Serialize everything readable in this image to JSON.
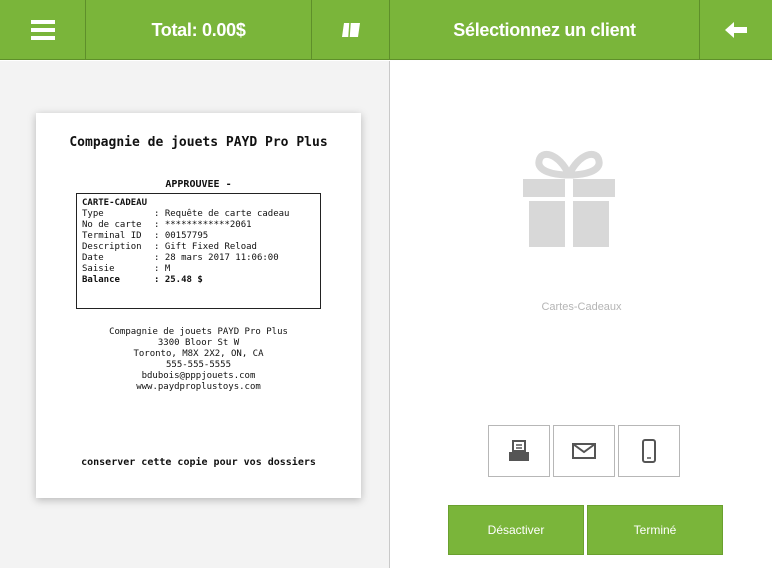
{
  "topbar": {
    "menu_icon": "hamburger-menu-icon",
    "total_label": "Total: 0.00$",
    "drawer_icon": "cash-drawer-icon",
    "title": "Sélectionnez un client",
    "back_icon": "arrow-left-icon"
  },
  "receipt": {
    "company": "Compagnie de jouets PAYD Pro Plus",
    "status": "APPROUVEE -",
    "card_title": "CARTE-CADEAU",
    "rows": [
      {
        "key": "Type",
        "value": ": Requête de carte cadeau"
      },
      {
        "key": "No de carte",
        "value": ": ************2061"
      },
      {
        "key": "Terminal ID",
        "value": ": 00157795"
      },
      {
        "key": "Description",
        "value": ": Gift Fixed Reload"
      },
      {
        "key": "Date",
        "value": ": 28 mars 2017 11:06:00"
      },
      {
        "key": "Saisie",
        "value": ": M"
      },
      {
        "key": "Balance",
        "value": ": 25.48 $"
      }
    ],
    "address": [
      "Compagnie de jouets PAYD Pro Plus",
      "3300 Bloor St W",
      "Toronto, M8X 2X2, ON, CA",
      "555-555-5555",
      "bdubois@pppjouets.com",
      "www.paydproplustoys.com"
    ],
    "footer": "conserver cette copie pour vos dossiers"
  },
  "right": {
    "gift_icon": "gift-icon",
    "gift_label": "Cartes-Cadeaux",
    "share": {
      "print_icon": "printer-icon",
      "mail_icon": "envelope-icon",
      "sms_icon": "mobile-phone-icon"
    },
    "deactivate_label": "Désactiver",
    "done_label": "Terminé"
  },
  "colors": {
    "accent": "#7ab53a",
    "icon_grey": "#d8d8d8"
  }
}
